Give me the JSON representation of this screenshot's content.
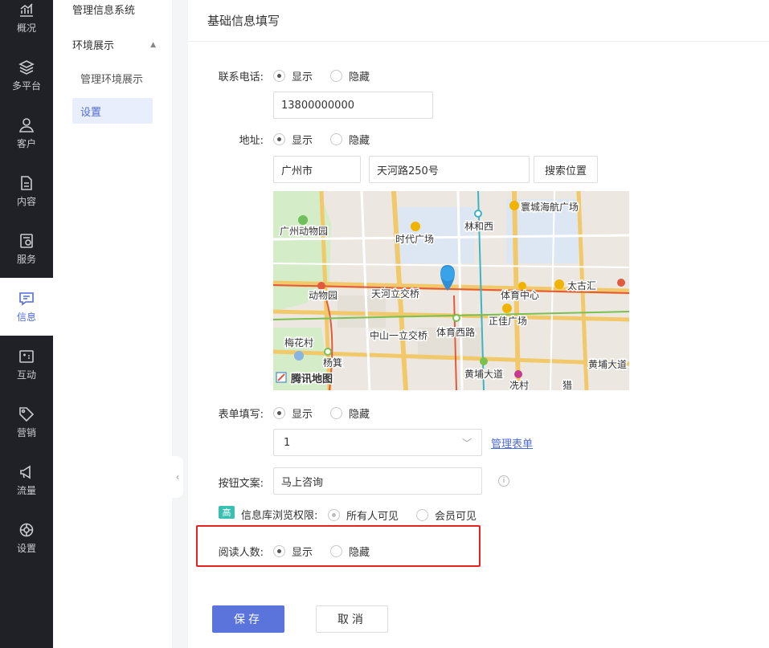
{
  "rail": {
    "items": [
      {
        "label": "概况",
        "icon": "chart-icon"
      },
      {
        "label": "多平台",
        "icon": "layers-icon"
      },
      {
        "label": "客户",
        "icon": "user-icon"
      },
      {
        "label": "内容",
        "icon": "document-icon"
      },
      {
        "label": "服务",
        "icon": "service-icon"
      },
      {
        "label": "信息",
        "icon": "message-icon",
        "active": true
      },
      {
        "label": "互动",
        "icon": "interaction-icon"
      },
      {
        "label": "营销",
        "icon": "tag-icon"
      },
      {
        "label": "流量",
        "icon": "megaphone-icon"
      },
      {
        "label": "设置",
        "icon": "gear-icon"
      }
    ],
    "active_color": "#4f6bdc"
  },
  "subnav": {
    "manage_system": "管理信息系统",
    "section": "环境展示",
    "child_manage": "管理环境展示",
    "child_settings": "设置"
  },
  "main": {
    "title": "基础信息填写",
    "phone": {
      "label": "联系电话:",
      "show": "显示",
      "hide": "隐藏",
      "value": "13800000000"
    },
    "address": {
      "label": "地址:",
      "show": "显示",
      "hide": "隐藏",
      "city": "广州市",
      "street": "天河路250号",
      "search_button": "搜索位置"
    },
    "map": {
      "labels": [
        "广州动物园",
        "时代广场",
        "林和西",
        "寰城海航广场",
        "动物园",
        "天河立交桥",
        "体育中心",
        "太古汇",
        "梅花村",
        "中山一立交桥",
        "体育西路",
        "正佳广场",
        "杨箕",
        "黄埔大道",
        "黄埔大道",
        "冼村",
        "猎"
      ],
      "brand": "腾讯地图"
    },
    "form_fill": {
      "label": "表单填写:",
      "show": "显示",
      "hide": "隐藏",
      "selected": "1",
      "manage_link": "管理表单"
    },
    "button_text": {
      "label": "按钮文案:",
      "value": "马上咨询"
    },
    "permission": {
      "badge": "高",
      "label": "信息库浏览权限:",
      "all": "所有人可见",
      "members": "会员可见"
    },
    "read_count": {
      "label": "阅读人数:",
      "show": "显示",
      "hide": "隐藏"
    },
    "save": "保存",
    "cancel": "取消"
  }
}
